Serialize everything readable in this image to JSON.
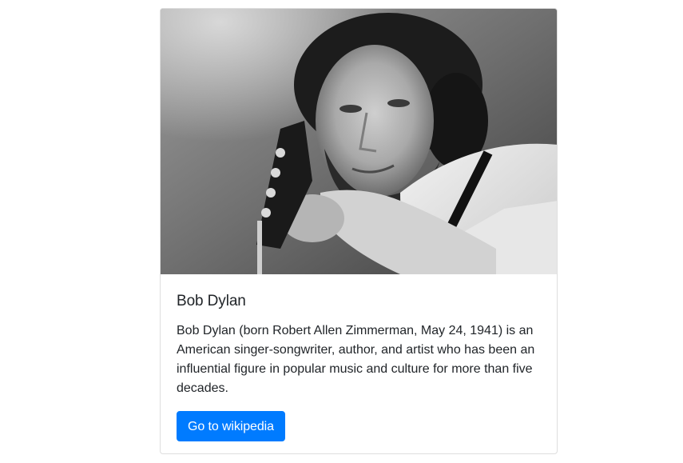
{
  "card": {
    "image_alt": "Bob Dylan",
    "title": "Bob Dylan",
    "text": "Bob Dylan (born Robert Allen Zimmerman, May 24, 1941) is an American singer-songwriter, author, and artist who has been an influential figure in popular music and culture for more than five decades.",
    "button_label": "Go to wikipedia"
  },
  "colors": {
    "primary_button": "#007bff",
    "text": "#212529",
    "border": "#dfdfdf"
  }
}
